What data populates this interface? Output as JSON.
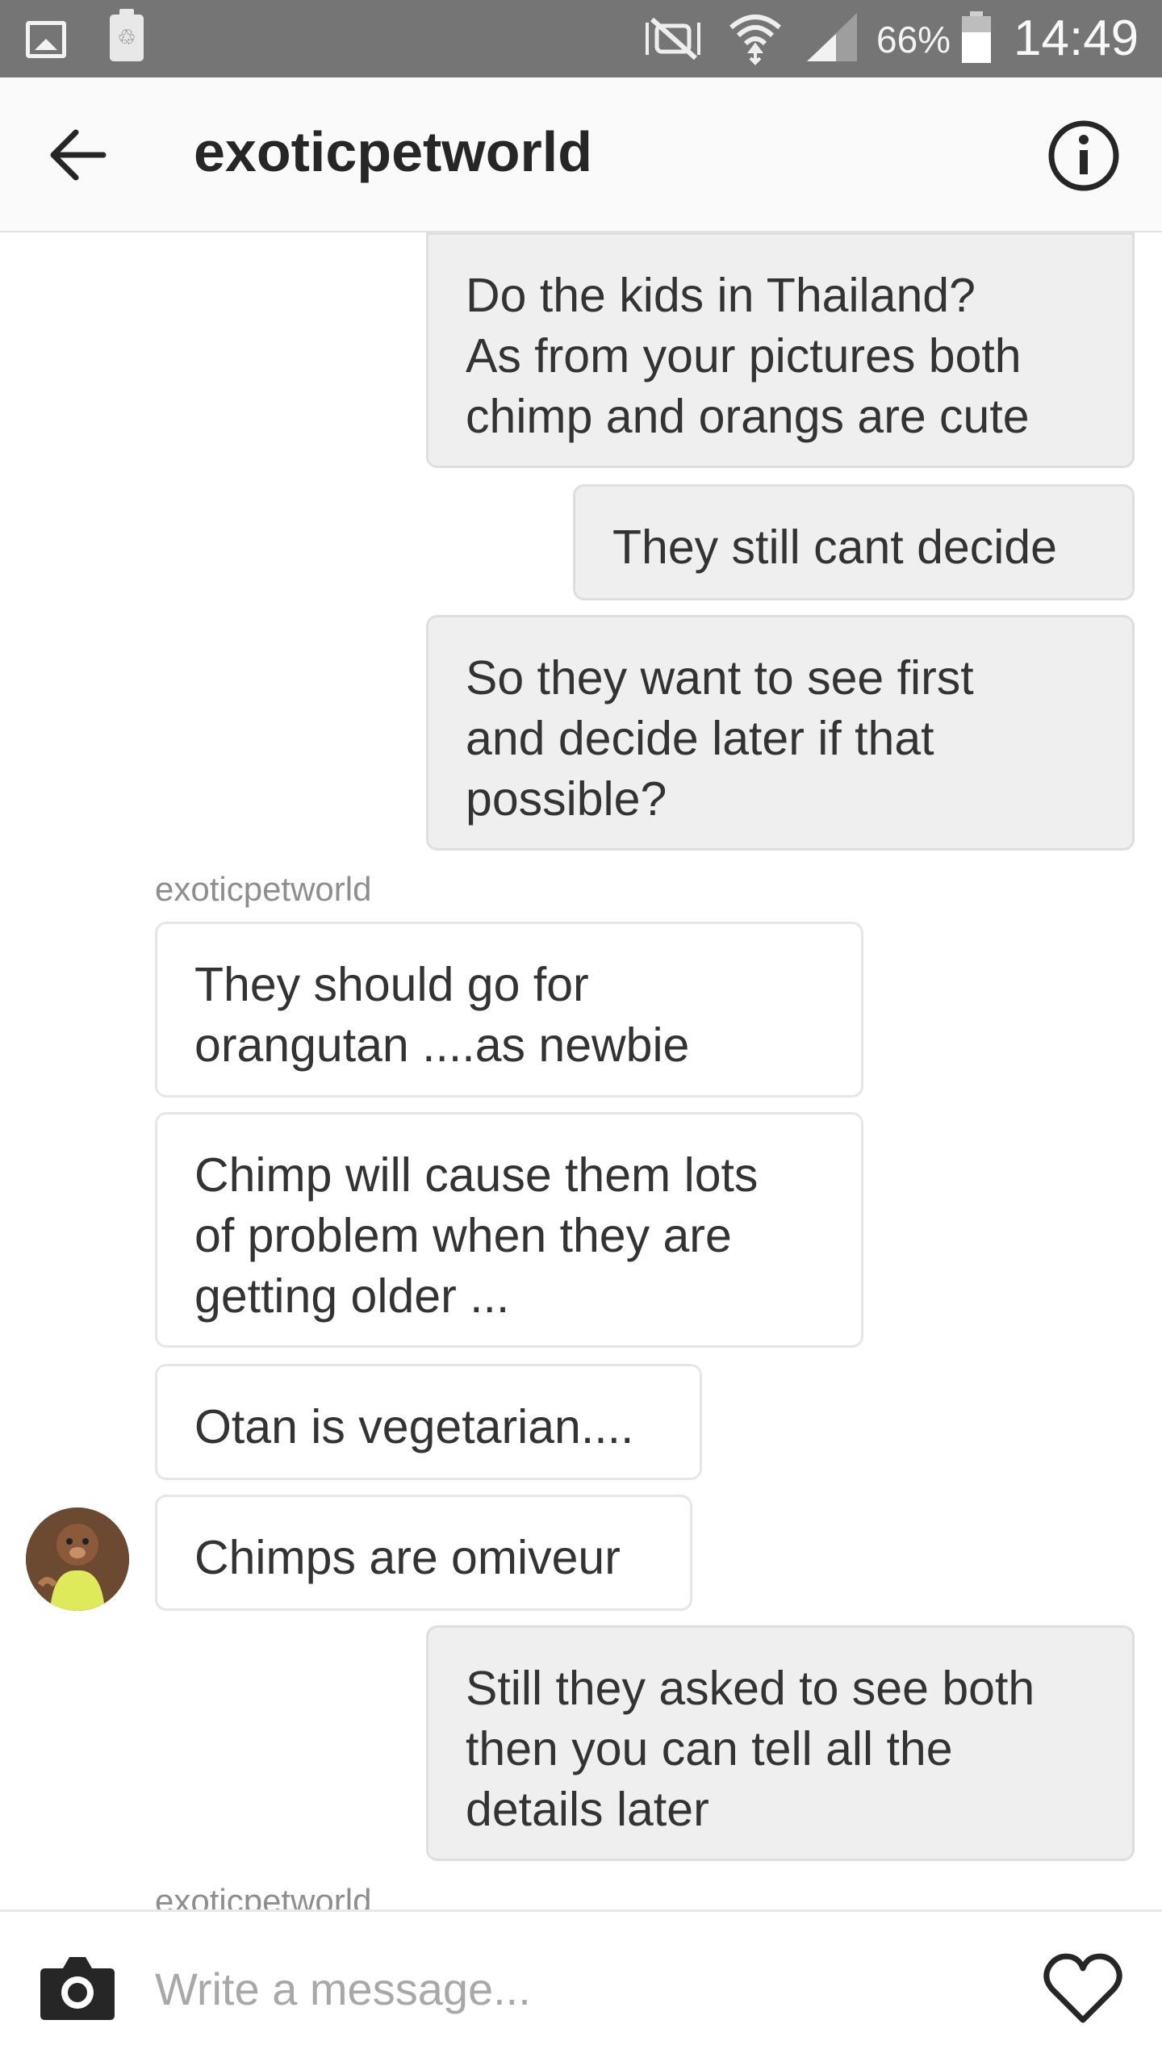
{
  "status_bar": {
    "battery_percent": "66%",
    "time": "14:49",
    "icons": [
      "gallery-icon",
      "battery-saver-icon",
      "mute-icon",
      "wifi-icon",
      "signal-icon",
      "battery-icon"
    ]
  },
  "header": {
    "title": "exoticpetworld",
    "icons": [
      "back-arrow-icon",
      "info-icon"
    ]
  },
  "messages": [
    {
      "side": "sent",
      "text": "Do the kids in Thailand?\nAs from your pictures both\nchimp and orangs are cute"
    },
    {
      "side": "sent",
      "text": "They still cant decide"
    },
    {
      "side": "sent",
      "text": "So they want to see first\nand decide later if that\npossible?"
    },
    {
      "side": "received",
      "sender": "exoticpetworld",
      "text": "They should go for\norangutan ....as newbie"
    },
    {
      "side": "received",
      "text": "Chimp will cause them lots\nof problem when they are\ngetting older ..."
    },
    {
      "side": "received",
      "text": "Otan is vegetarian...."
    },
    {
      "side": "received",
      "text": "Chimps are omiveur"
    },
    {
      "side": "sent",
      "text": "Still they asked to see both\nthen you can tell all the\ndetails later"
    },
    {
      "side": "received",
      "sender": "exoticpetworld"
    }
  ],
  "composer": {
    "placeholder": "Write a message...",
    "icons": [
      "camera-icon",
      "heart-icon"
    ]
  },
  "colors": {
    "status_bar_bg": "#757575",
    "sent_bubble_bg": "#efefef",
    "received_bubble_border": "#e6e6e6",
    "secondary_text": "#8e8e8e"
  }
}
